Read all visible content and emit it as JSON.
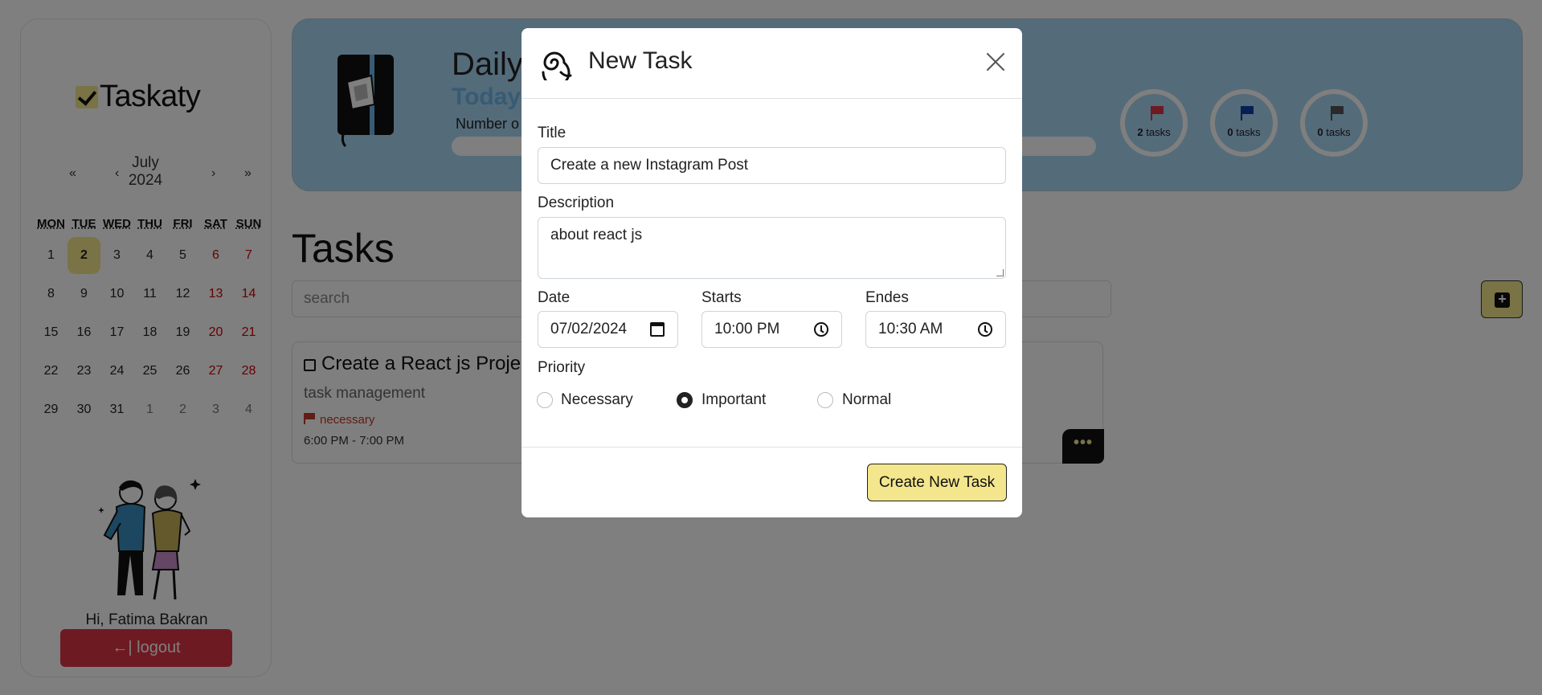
{
  "sidebar": {
    "logo_text": "Taskaty",
    "calendar": {
      "prev_year": "«",
      "prev_month": "‹",
      "month": "July",
      "year": "2024",
      "next_month": "›",
      "next_year": "»",
      "weekdays": [
        "MON",
        "TUE",
        "WED",
        "THU",
        "FRI",
        "SAT",
        "SUN"
      ],
      "weeks": [
        [
          "1",
          "2",
          "3",
          "4",
          "5",
          "6",
          "7"
        ],
        [
          "8",
          "9",
          "10",
          "11",
          "12",
          "13",
          "14"
        ],
        [
          "15",
          "16",
          "17",
          "18",
          "19",
          "20",
          "21"
        ],
        [
          "22",
          "23",
          "24",
          "25",
          "26",
          "27",
          "28"
        ],
        [
          "29",
          "30",
          "31",
          "1",
          "2",
          "3",
          "4"
        ]
      ],
      "selected_day": "2"
    },
    "greeting": "Hi, Fatima Bakran",
    "logout_label": "logout",
    "logout_icon": "exit-arrow-icon"
  },
  "header": {
    "title": "Daily",
    "subtitle": "Today",
    "count_label": "Number o",
    "stats": [
      {
        "count": "2",
        "label": "tasks",
        "flag_color": "#dc3545"
      },
      {
        "count": "0",
        "label": "tasks",
        "flag_color": "#0d3fa6"
      },
      {
        "count": "0",
        "label": "tasks",
        "flag_color": "#555555"
      }
    ]
  },
  "tasks_section": {
    "title": "Tasks",
    "search_placeholder": "search",
    "add_icon": "plus-square-icon",
    "cards": [
      {
        "title": "Create a React js Project",
        "description": "task management",
        "priority": "necessary",
        "time": "6:00 PM - 7:00 PM",
        "menu": "•••"
      }
    ]
  },
  "modal": {
    "title": "New Task",
    "title_label": "Title",
    "title_value": "Create a new Instagram Post",
    "description_label": "Description",
    "description_value": "about react js",
    "date_label": "Date",
    "date_value": "07/02/2024",
    "starts_label": "Starts",
    "starts_value": "10:00 PM",
    "ends_label": "Endes",
    "ends_value": "10:30 AM",
    "priority_label": "Priority",
    "priority_options": [
      "Necessary",
      "Important",
      "Normal"
    ],
    "priority_selected": "Important",
    "submit_label": "Create New Task"
  },
  "colors": {
    "accent_yellow": "#f3e68c",
    "header_blue": "#a8d6f5",
    "danger": "#dc3545"
  }
}
